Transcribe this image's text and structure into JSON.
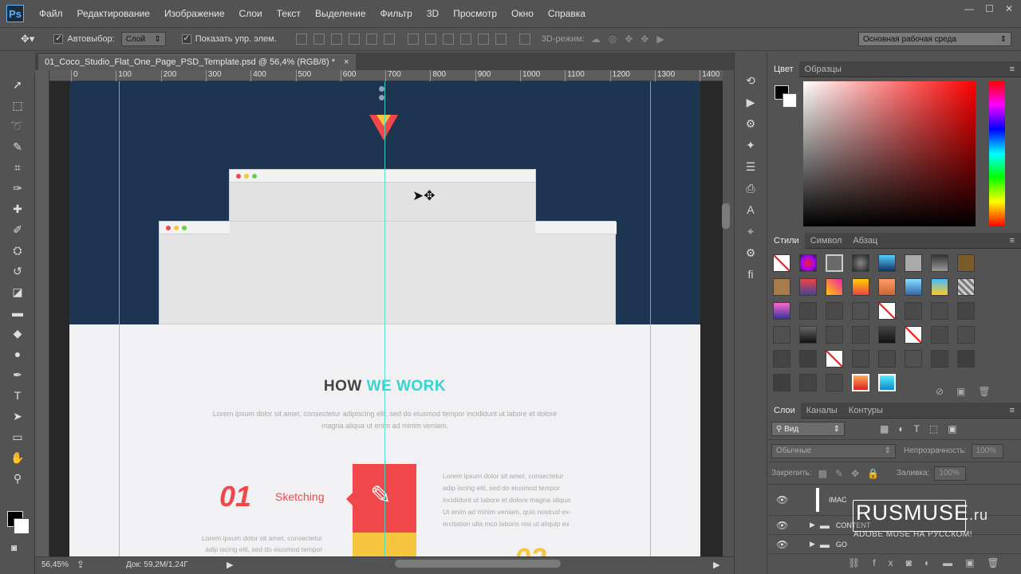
{
  "app": {
    "logo": "Ps"
  },
  "menu": [
    "Файл",
    "Редактирование",
    "Изображение",
    "Слои",
    "Текст",
    "Выделение",
    "Фильтр",
    "3D",
    "Просмотр",
    "Окно",
    "Справка"
  ],
  "window_controls": [
    "—",
    "☐",
    "✕"
  ],
  "options": {
    "autoselect_label": "Автовыбор:",
    "autoselect_value": "Слой",
    "show_transform_label": "Показать упр. элем.",
    "mode_3d_label": "3D-режим:",
    "workspace": "Основная рабочая среда"
  },
  "document": {
    "tab_title": "01_Coco_Studio_Flat_One_Page_PSD_Template.psd @ 56,4% (RGB/8) *",
    "close": "×"
  },
  "ruler_labels": [
    "0",
    "100",
    "200",
    "300",
    "400",
    "500",
    "600",
    "700",
    "800",
    "900",
    "1000",
    "1100",
    "1200",
    "1300",
    "1400"
  ],
  "canvas": {
    "section_title_part1": "HOW",
    "section_title_part2": "WE WORK",
    "intro_line1": "Lorem ipsum dolor sit amet, consectetur adipiscing elit, sed do eiusmod tempor incididunt ut labore et dolore",
    "intro_line2": "magna aliqua ut enim ad minim veniam.",
    "step1_number": "01",
    "step1_label": "Sketching",
    "step1_text": [
      "Lorem ipsum dolor sit amet, consectetur",
      "adip iscing elit, sed do eiusmod tempor",
      "incididunt ut labore et dolore magna aliqua",
      "Ut enim ad minim veniam, quis nostrud ex-",
      "ercitation ulla mco laboris nisi ut aliquip ex"
    ],
    "left_text": [
      "Lorem ipsum dolor sit amet, consectetur",
      "adip iscing elit, sed do eiusmod tempor"
    ],
    "step2_number_partial": "02",
    "colors": {
      "hero_bg": "#1d3550",
      "accent_teal": "#35d6cf",
      "accent_red": "#f0474a",
      "accent_yellow": "#f6c641"
    }
  },
  "status": {
    "zoom": "56,45%",
    "doc_info": "Док: 59,2M/1,24Г"
  },
  "color_panel": {
    "tabs": [
      "Цвет",
      "Образцы"
    ]
  },
  "styles_panel": {
    "tabs": [
      "Стили",
      "Символ",
      "Абзац"
    ]
  },
  "layers_panel": {
    "tabs": [
      "Слои",
      "Каналы",
      "Контуры"
    ],
    "filter_kind": "Вид",
    "blend_mode": "Обычные",
    "opacity_label": "Непрозрачность:",
    "opacity_value": "100%",
    "lock_label": "Закрепить:",
    "fill_label": "Заливка:",
    "fill_value": "100%",
    "layers": [
      {
        "name": "IMAC",
        "type": "layer"
      },
      {
        "name": "CONTENT",
        "type": "group"
      },
      {
        "name": "GO",
        "type": "group"
      }
    ]
  },
  "watermark": {
    "title": "RUSMUSE",
    "suffix": ".ru",
    "subtitle": "ADOBE MUSE НА РУССКОМ!"
  }
}
